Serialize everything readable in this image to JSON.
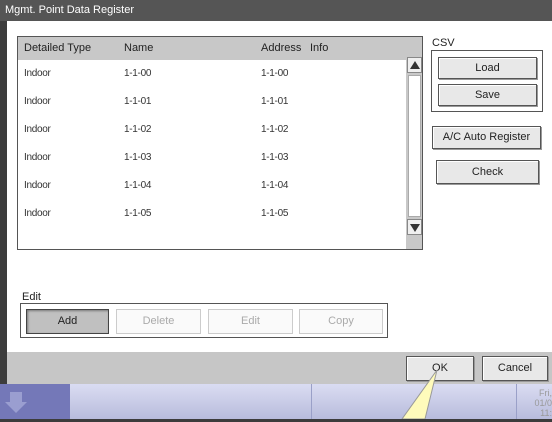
{
  "window": {
    "title": "Mgmt. Point Data Register"
  },
  "table": {
    "columns": [
      "Detailed Type",
      "Name",
      "Address",
      "Info"
    ],
    "rows": [
      [
        "Indoor",
        "1-1-00",
        "1-1-00",
        ""
      ],
      [
        "Indoor",
        "1-1-01",
        "1-1-01",
        ""
      ],
      [
        "Indoor",
        "1-1-02",
        "1-1-02",
        ""
      ],
      [
        "Indoor",
        "1-1-03",
        "1-1-03",
        ""
      ],
      [
        "Indoor",
        "1-1-04",
        "1-1-04",
        ""
      ],
      [
        "Indoor",
        "1-1-05",
        "1-1-05",
        ""
      ]
    ]
  },
  "csv": {
    "label": "CSV",
    "load": "Load",
    "save": "Save"
  },
  "actions": {
    "auto_register": "A/C Auto Register",
    "check": "Check"
  },
  "edit": {
    "label": "Edit",
    "add": "Add",
    "delete": "Delete",
    "edit": "Edit",
    "copy": "Copy"
  },
  "footer": {
    "ok": "OK",
    "cancel": "Cancel"
  },
  "taskbar": {
    "date": "Fri, 01/0",
    "time": "11:"
  },
  "colors": {
    "title_bg": "#555555",
    "header_bg": "#c8c8c8",
    "footer_bg": "#c6c6c6",
    "taskbar_accent": "#7478b8"
  },
  "icons": {
    "scroll_up": "triangle-up-icon",
    "scroll_down": "triangle-down-icon",
    "taskbar_menu": "taskbar-menu-icon"
  }
}
